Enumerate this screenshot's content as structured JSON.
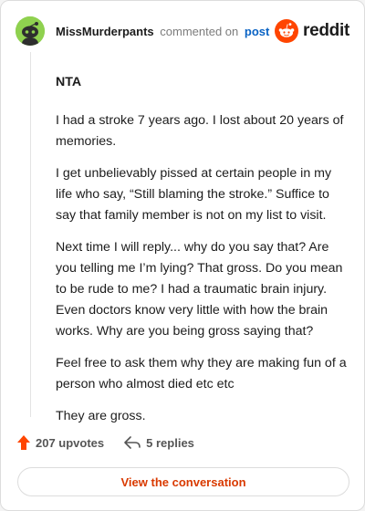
{
  "header": {
    "username": "MissMurderpants",
    "action": "commented on",
    "post_link": "post",
    "logo_text": "reddit"
  },
  "comment": {
    "title": "NTA",
    "paragraphs": [
      "I had a stroke 7 years ago. I lost about 20 years of memories.",
      "I get unbelievably pissed at certain people in my life who say, “Still blaming the stroke.” Suffice to say that family member is not on my list to visit.",
      "Next time I will reply... why do you say that? Are you telling me I’m lying? That gross. Do you mean to be rude to me? I had a traumatic brain injury. Even doctors know very little with how the brain works. Why are you being gross saying that?",
      "Feel free to ask them why they are making fun of a person who almost died etc etc",
      "They are gross."
    ]
  },
  "footer": {
    "upvotes_label": "207 upvotes",
    "replies_label": "5 replies",
    "cta_label": "View the conversation"
  },
  "colors": {
    "accent": "#ff4500",
    "link": "#0a63c4",
    "cta_text": "#d93a00",
    "avatar_bg": "#8fd14f"
  },
  "icons": {
    "avatar": "snoo-avatar-icon",
    "logo": "reddit-logo-icon",
    "upvote": "upvote-arrow-icon",
    "reply": "reply-arrow-icon"
  }
}
